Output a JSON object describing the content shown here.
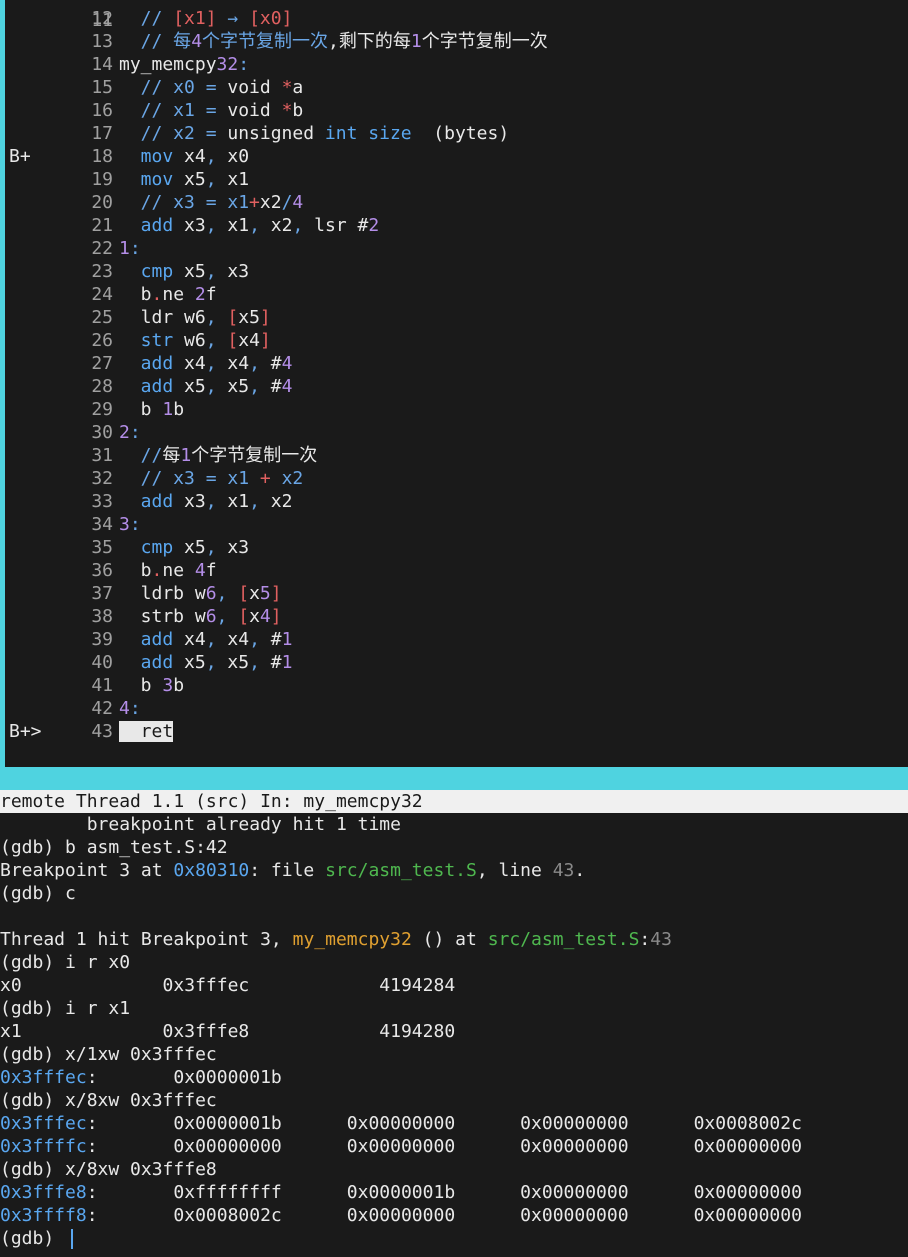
{
  "source": {
    "lines": [
      {
        "no": "12",
        "marker": "",
        "parts": [
          [
            "cmt",
            "  // "
          ],
          [
            "brk",
            "[x1]"
          ],
          [
            "cmt",
            " → "
          ],
          [
            "brk",
            "[x0]"
          ]
        ]
      },
      {
        "no": "13",
        "marker": "",
        "parts": [
          [
            "cmt",
            "  // 每"
          ],
          [
            "num",
            "4"
          ],
          [
            "cmt",
            "个字节复制一次"
          ],
          [
            "white",
            ","
          ],
          [
            "white",
            "剩下的每"
          ],
          [
            "num",
            "1"
          ],
          [
            "white",
            "个字节复制一次"
          ]
        ]
      },
      {
        "no": "14",
        "marker": "",
        "parts": [
          [
            "white",
            "my_memcpy"
          ],
          [
            "num",
            "32"
          ],
          [
            "lbl",
            ":"
          ]
        ]
      },
      {
        "no": "15",
        "marker": "",
        "parts": [
          [
            "cmt",
            "  // x0 = "
          ],
          [
            "white",
            "void "
          ],
          [
            "brk",
            "*"
          ],
          [
            "white",
            "a"
          ]
        ]
      },
      {
        "no": "16",
        "marker": "",
        "parts": [
          [
            "cmt",
            "  // x1 = "
          ],
          [
            "white",
            "void "
          ],
          [
            "brk",
            "*"
          ],
          [
            "white",
            "b"
          ]
        ]
      },
      {
        "no": "17",
        "marker": "",
        "parts": [
          [
            "cmt",
            "  // x2 = "
          ],
          [
            "white",
            "unsigned "
          ],
          [
            "kw",
            "int size"
          ],
          [
            "white",
            "  (bytes)"
          ]
        ]
      },
      {
        "no": "18",
        "marker": "B+",
        "parts": [
          [
            "kw",
            "  mov "
          ],
          [
            "white",
            "x4"
          ],
          [
            "cmt",
            ", "
          ],
          [
            "white",
            "x0"
          ]
        ]
      },
      {
        "no": "19",
        "marker": "",
        "parts": [
          [
            "kw",
            "  mov "
          ],
          [
            "white",
            "x5"
          ],
          [
            "cmt",
            ", "
          ],
          [
            "white",
            "x1"
          ]
        ]
      },
      {
        "no": "20",
        "marker": "",
        "parts": [
          [
            "cmt",
            "  // x3 = x1"
          ],
          [
            "brk",
            "+"
          ],
          [
            "white",
            "x2"
          ],
          [
            "cmt",
            "/"
          ],
          [
            "num",
            "4"
          ]
        ]
      },
      {
        "no": "21",
        "marker": "",
        "parts": [
          [
            "kw",
            "  add "
          ],
          [
            "white",
            "x3"
          ],
          [
            "cmt",
            ", "
          ],
          [
            "white",
            "x1"
          ],
          [
            "cmt",
            ", "
          ],
          [
            "white",
            "x2"
          ],
          [
            "cmt",
            ", "
          ],
          [
            "white",
            "lsr "
          ],
          [
            "white",
            "#"
          ],
          [
            "num",
            "2"
          ]
        ]
      },
      {
        "no": "22",
        "marker": "",
        "parts": [
          [
            "num",
            "1"
          ],
          [
            "lbl",
            ":"
          ]
        ]
      },
      {
        "no": "23",
        "marker": "",
        "parts": [
          [
            "kw",
            "  cmp "
          ],
          [
            "white",
            "x5"
          ],
          [
            "cmt",
            ", "
          ],
          [
            "white",
            "x3"
          ]
        ]
      },
      {
        "no": "24",
        "marker": "",
        "parts": [
          [
            "white",
            "  b"
          ],
          [
            "brk",
            "."
          ],
          [
            "white",
            "ne "
          ],
          [
            "num",
            "2"
          ],
          [
            "white",
            "f"
          ]
        ]
      },
      {
        "no": "25",
        "marker": "",
        "parts": [
          [
            "white",
            "  ldr w6"
          ],
          [
            "cmt",
            ", "
          ],
          [
            "brk",
            "["
          ],
          [
            "white",
            "x5"
          ],
          [
            "brk",
            "]"
          ]
        ]
      },
      {
        "no": "26",
        "marker": "",
        "parts": [
          [
            "kw",
            "  str "
          ],
          [
            "white",
            "w6"
          ],
          [
            "cmt",
            ", "
          ],
          [
            "brk",
            "["
          ],
          [
            "white",
            "x4"
          ],
          [
            "brk",
            "]"
          ]
        ]
      },
      {
        "no": "27",
        "marker": "",
        "parts": [
          [
            "kw",
            "  add "
          ],
          [
            "white",
            "x4"
          ],
          [
            "cmt",
            ", "
          ],
          [
            "white",
            "x4"
          ],
          [
            "cmt",
            ", "
          ],
          [
            "white",
            "#"
          ],
          [
            "num",
            "4"
          ]
        ]
      },
      {
        "no": "28",
        "marker": "",
        "parts": [
          [
            "kw",
            "  add "
          ],
          [
            "white",
            "x5"
          ],
          [
            "cmt",
            ", "
          ],
          [
            "white",
            "x5"
          ],
          [
            "cmt",
            ", "
          ],
          [
            "white",
            "#"
          ],
          [
            "num",
            "4"
          ]
        ]
      },
      {
        "no": "29",
        "marker": "",
        "parts": [
          [
            "white",
            "  b "
          ],
          [
            "num",
            "1"
          ],
          [
            "white",
            "b"
          ]
        ]
      },
      {
        "no": "30",
        "marker": "",
        "parts": [
          [
            "num",
            "2"
          ],
          [
            "lbl",
            ":"
          ]
        ]
      },
      {
        "no": "31",
        "marker": "",
        "parts": [
          [
            "cmt",
            "  //"
          ],
          [
            "white",
            "每"
          ],
          [
            "num",
            "1"
          ],
          [
            "white",
            "个字节复制一次"
          ]
        ]
      },
      {
        "no": "32",
        "marker": "",
        "parts": [
          [
            "cmt",
            "  // x3 = x1 "
          ],
          [
            "brk",
            "+"
          ],
          [
            "cmt",
            " x2"
          ]
        ]
      },
      {
        "no": "33",
        "marker": "",
        "parts": [
          [
            "kw",
            "  add "
          ],
          [
            "white",
            "x3"
          ],
          [
            "cmt",
            ", "
          ],
          [
            "white",
            "x1"
          ],
          [
            "cmt",
            ", "
          ],
          [
            "white",
            "x2"
          ]
        ]
      },
      {
        "no": "34",
        "marker": "",
        "parts": [
          [
            "num",
            "3"
          ],
          [
            "lbl",
            ":"
          ]
        ]
      },
      {
        "no": "35",
        "marker": "",
        "parts": [
          [
            "kw",
            "  cmp "
          ],
          [
            "white",
            "x5"
          ],
          [
            "cmt",
            ", "
          ],
          [
            "white",
            "x3"
          ]
        ]
      },
      {
        "no": "36",
        "marker": "",
        "parts": [
          [
            "white",
            "  b"
          ],
          [
            "brk",
            "."
          ],
          [
            "white",
            "ne "
          ],
          [
            "num",
            "4"
          ],
          [
            "white",
            "f"
          ]
        ]
      },
      {
        "no": "37",
        "marker": "",
        "parts": [
          [
            "white",
            "  ldrb w"
          ],
          [
            "num",
            "6"
          ],
          [
            "cmt",
            ", "
          ],
          [
            "brk",
            "["
          ],
          [
            "white",
            "x"
          ],
          [
            "num",
            "5"
          ],
          [
            "brk",
            "]"
          ]
        ]
      },
      {
        "no": "38",
        "marker": "",
        "parts": [
          [
            "white",
            "  strb w"
          ],
          [
            "num",
            "6"
          ],
          [
            "cmt",
            ", "
          ],
          [
            "brk",
            "["
          ],
          [
            "white",
            "x"
          ],
          [
            "num",
            "4"
          ],
          [
            "brk",
            "]"
          ]
        ]
      },
      {
        "no": "39",
        "marker": "",
        "parts": [
          [
            "kw",
            "  add "
          ],
          [
            "white",
            "x4"
          ],
          [
            "cmt",
            ", "
          ],
          [
            "white",
            "x4"
          ],
          [
            "cmt",
            ", "
          ],
          [
            "white",
            "#"
          ],
          [
            "num",
            "1"
          ]
        ]
      },
      {
        "no": "40",
        "marker": "",
        "parts": [
          [
            "kw",
            "  add "
          ],
          [
            "white",
            "x5"
          ],
          [
            "cmt",
            ", "
          ],
          [
            "white",
            "x5"
          ],
          [
            "cmt",
            ", "
          ],
          [
            "white",
            "#"
          ],
          [
            "num",
            "1"
          ]
        ]
      },
      {
        "no": "41",
        "marker": "",
        "parts": [
          [
            "white",
            "  b "
          ],
          [
            "num",
            "3"
          ],
          [
            "white",
            "b"
          ]
        ]
      },
      {
        "no": "42",
        "marker": "",
        "parts": [
          [
            "num",
            "4"
          ],
          [
            "lbl",
            ":"
          ]
        ]
      },
      {
        "no": "43",
        "marker": "B+>",
        "parts": [
          [
            "cur",
            "  ret"
          ]
        ]
      }
    ]
  },
  "status_bar": "remote Thread 1.1 (src) In: my_memcpy32",
  "console": [
    [
      [
        "white",
        "        breakpoint already hit 1 time"
      ]
    ],
    [
      [
        "white",
        "(gdb) b asm_test.S:42"
      ]
    ],
    [
      [
        "white",
        "Breakpoint 3 at "
      ],
      [
        "addr",
        "0x80310"
      ],
      [
        "white",
        ": file "
      ],
      [
        "file",
        "src/asm_test.S"
      ],
      [
        "white",
        ", line "
      ],
      [
        "dim",
        "43"
      ],
      [
        "white",
        "."
      ]
    ],
    [
      [
        "white",
        "(gdb) c"
      ]
    ],
    [
      [
        "white",
        ""
      ]
    ],
    [
      [
        "white",
        "Thread 1 hit Breakpoint 3, "
      ],
      [
        "func",
        "my_memcpy32"
      ],
      [
        "white",
        " () at "
      ],
      [
        "file",
        "src/asm_test.S"
      ],
      [
        "white",
        ":"
      ],
      [
        "dim",
        "43"
      ]
    ],
    [
      [
        "white",
        "(gdb) i r x0"
      ]
    ],
    [
      [
        "white",
        "x0             0x3fffec            4194284"
      ]
    ],
    [
      [
        "white",
        "(gdb) i r x1"
      ]
    ],
    [
      [
        "white",
        "x1             0x3fffe8            4194280"
      ]
    ],
    [
      [
        "white",
        "(gdb) x/1xw 0x3fffec"
      ]
    ],
    [
      [
        "addr",
        "0x3fffec"
      ],
      [
        "white",
        ":       0x0000001b"
      ]
    ],
    [
      [
        "white",
        "(gdb) x/8xw 0x3fffec"
      ]
    ],
    [
      [
        "addr",
        "0x3fffec"
      ],
      [
        "white",
        ":       0x0000001b      0x00000000      0x00000000      0x0008002c"
      ]
    ],
    [
      [
        "addr",
        "0x3ffffc"
      ],
      [
        "white",
        ":       0x00000000      0x00000000      0x00000000      0x00000000"
      ]
    ],
    [
      [
        "white",
        "(gdb) x/8xw 0x3fffe8"
      ]
    ],
    [
      [
        "addr",
        "0x3fffe8"
      ],
      [
        "white",
        ":       0xffffffff      0x0000001b      0x00000000      0x00000000"
      ]
    ],
    [
      [
        "addr",
        "0x3ffff8"
      ],
      [
        "white",
        ":       0x0008002c      0x00000000      0x00000000      0x00000000"
      ]
    ]
  ],
  "prompt": "(gdb) ",
  "partial_top_lineno": "11"
}
